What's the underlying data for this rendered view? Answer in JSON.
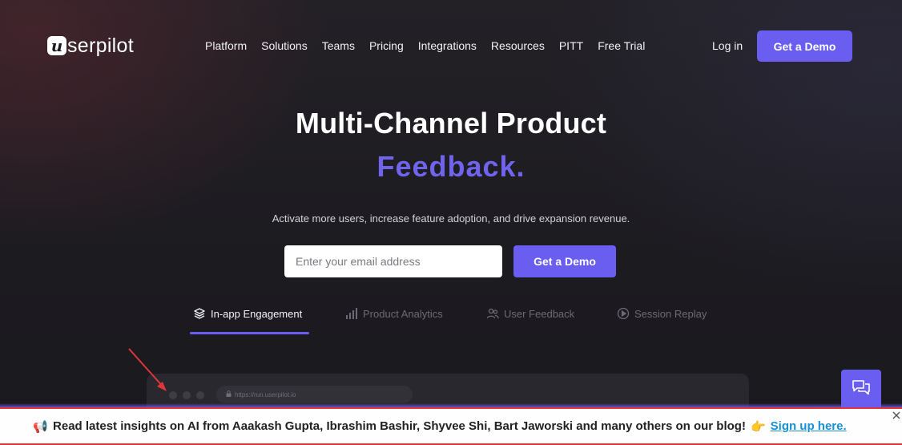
{
  "brand": {
    "logo_mark": "u",
    "logo_text": "serpilot"
  },
  "nav": {
    "items": [
      "Platform",
      "Solutions",
      "Teams",
      "Pricing",
      "Integrations",
      "Resources",
      "PITT",
      "Free Trial"
    ],
    "login_label": "Log in",
    "demo_label": "Get a Demo"
  },
  "hero": {
    "title": "Multi-Channel Product",
    "accent": "Feedback.",
    "accent_color": "#7064ef",
    "subtitle": "Activate more users, increase feature adoption, and drive expansion revenue.",
    "email_placeholder": "Enter your email address",
    "cta_label": "Get a Demo"
  },
  "tabs": [
    {
      "label": "In-app Engagement",
      "icon": "layers-icon",
      "active": true
    },
    {
      "label": "Product Analytics",
      "icon": "bar-chart-icon",
      "active": false
    },
    {
      "label": "User Feedback",
      "icon": "users-icon",
      "active": false
    },
    {
      "label": "Session Replay",
      "icon": "play-circle-icon",
      "active": false
    }
  ],
  "mock_browser": {
    "url": "https://run.userpilot.io"
  },
  "banner": {
    "emoji_start": "📢",
    "text": "Read latest insights on AI from Aaakash Gupta, Ibrashim Bashir, Shyvee Shi, Bart Jaworski and many others on our blog!",
    "emoji_end": "👉",
    "link_label": "Sign up here."
  },
  "colors": {
    "accent": "#6a5ef0",
    "banner_border": "#e0363b",
    "link": "#1790d6"
  }
}
